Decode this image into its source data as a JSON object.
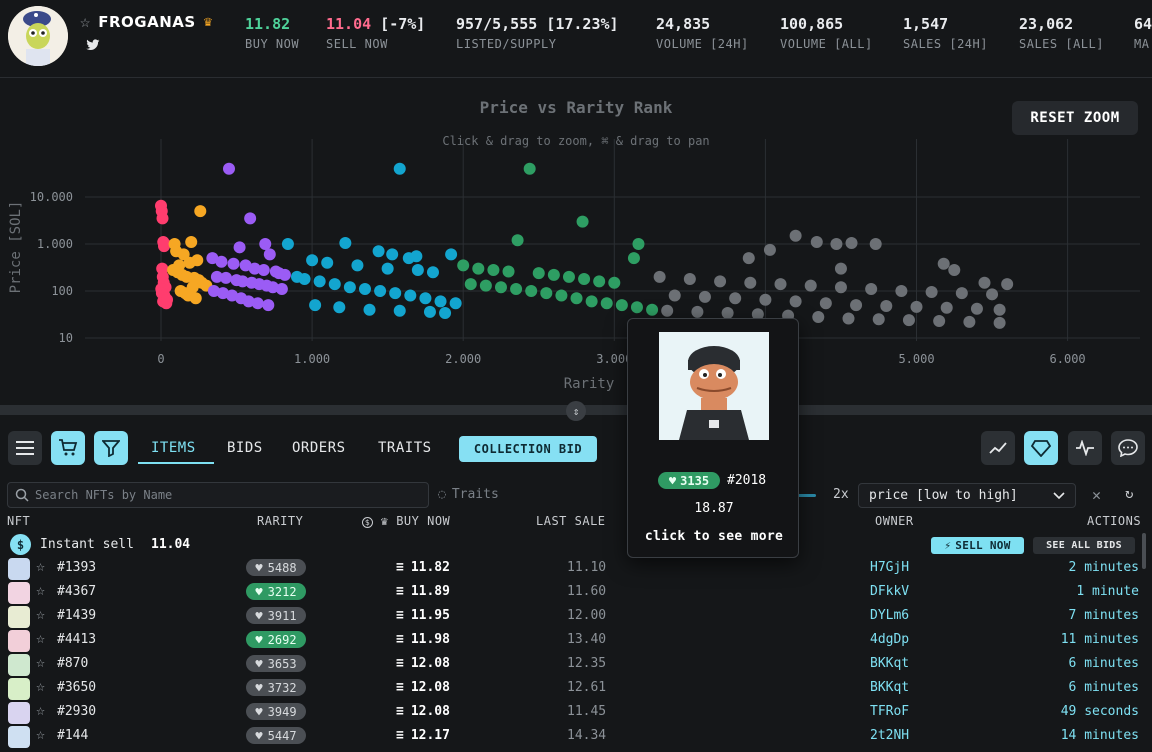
{
  "collection": {
    "name": "FROGANAS",
    "crown_icon": "crown-icon",
    "star_icon": "star-outline-icon",
    "social_icon": "twitter-icon"
  },
  "stats": [
    {
      "value": "11.82",
      "label": "BUY NOW",
      "color": "#4fd29a"
    },
    {
      "value": "11.04",
      "suffix": " [-7%]",
      "label": "SELL NOW",
      "color": "#ff6b8e"
    },
    {
      "value": "957/5,555 [17.23%]",
      "label": "LISTED/SUPPLY"
    },
    {
      "value": "24,835",
      "label": "VOLUME [24H]"
    },
    {
      "value": "100,865",
      "label": "VOLUME [ALL]"
    },
    {
      "value": "1,547",
      "label": "SALES [24H]"
    },
    {
      "value": "23,062",
      "label": "SALES [ALL]"
    },
    {
      "value": "64",
      "label": "MA"
    }
  ],
  "chart": {
    "reset_label": "RESET ZOOM"
  },
  "chart_data": {
    "type": "scatter",
    "title": "Price vs Rarity Rank",
    "subtitle": "Click & drag to zoom, ⌘ & drag to pan",
    "xlabel": "Rarity",
    "ylabel": "Price [SOL]",
    "xlim": [
      -50,
      6150
    ],
    "ylim_log": [
      10,
      30000
    ],
    "x_scale": "linear",
    "y_scale": "log",
    "x_ticks": [
      "0",
      "1.000",
      "2.000",
      "3.000",
      "4.000",
      "5.000",
      "6.000"
    ],
    "y_ticks": [
      "10",
      "100",
      "1.000",
      "10.000"
    ],
    "grid": true,
    "series": [
      {
        "color": "#ff3d6e",
        "x": [
          0,
          5,
          10,
          15,
          20,
          25,
          8,
          12,
          18,
          30,
          2,
          6,
          14,
          22,
          28,
          35,
          40
        ],
        "y": [
          6500,
          5000,
          3500,
          1100,
          900,
          1000,
          300,
          200,
          150,
          120,
          110,
          90,
          60,
          80,
          70,
          55,
          65
        ]
      },
      {
        "color": "#f6a723",
        "x": [
          90,
          100,
          150,
          200,
          260,
          240,
          190,
          120,
          80,
          110,
          140,
          170,
          220,
          250,
          270,
          300,
          210,
          130,
          160,
          180,
          230
        ],
        "y": [
          1000,
          700,
          600,
          1100,
          5000,
          450,
          400,
          350,
          280,
          250,
          220,
          200,
          190,
          170,
          150,
          130,
          120,
          100,
          90,
          80,
          70
        ]
      },
      {
        "color": "#9b5cf5",
        "x": [
          450,
          590,
          520,
          690,
          720,
          340,
          400,
          480,
          560,
          620,
          680,
          760,
          780,
          820,
          370,
          430,
          500,
          540,
          600,
          650,
          700,
          740,
          800,
          350,
          410,
          470,
          530,
          580,
          640,
          710
        ],
        "y": [
          40000,
          3500,
          850,
          1000,
          600,
          500,
          420,
          380,
          350,
          300,
          280,
          260,
          240,
          220,
          200,
          190,
          170,
          160,
          150,
          140,
          130,
          120,
          110,
          100,
          90,
          80,
          70,
          60,
          55,
          50
        ]
      },
      {
        "color": "#13a5cf",
        "x": [
          1580,
          840,
          1220,
          1440,
          1530,
          1640,
          1690,
          1920,
          1000,
          1100,
          1300,
          1500,
          1700,
          1800,
          900,
          950,
          1050,
          1150,
          1250,
          1350,
          1450,
          1550,
          1650,
          1750,
          1850,
          1950,
          1020,
          1180,
          1380,
          1580,
          1780,
          1880
        ],
        "y": [
          40000,
          1000,
          1050,
          700,
          600,
          500,
          550,
          600,
          450,
          400,
          350,
          300,
          280,
          250,
          200,
          180,
          160,
          140,
          120,
          110,
          100,
          90,
          80,
          70,
          60,
          55,
          50,
          45,
          40,
          38,
          36,
          34
        ]
      },
      {
        "color": "#2e9e63",
        "x": [
          2440,
          2790,
          2360,
          3160,
          3130,
          2000,
          2100,
          2200,
          2300,
          2500,
          2600,
          2700,
          2800,
          2900,
          3000,
          2050,
          2150,
          2250,
          2350,
          2450,
          2550,
          2650,
          2750,
          2850,
          2950,
          3050,
          3150,
          3250
        ],
        "y": [
          40000,
          3000,
          1200,
          1000,
          500,
          350,
          300,
          280,
          260,
          240,
          220,
          200,
          180,
          160,
          150,
          140,
          130,
          120,
          110,
          100,
          90,
          80,
          70,
          60,
          55,
          50,
          45,
          40
        ]
      },
      {
        "color": "#6c7075",
        "x": [
          4200,
          4340,
          4470,
          4570,
          4730,
          4030,
          3890,
          4500,
          5180,
          5250,
          5450,
          5600,
          3300,
          3500,
          3700,
          3900,
          4100,
          4300,
          4500,
          4700,
          4900,
          5100,
          5300,
          5500,
          3400,
          3600,
          3800,
          4000,
          4200,
          4400,
          4600,
          4800,
          5000,
          5200,
          5400,
          5550,
          3350,
          3550,
          3750,
          3950,
          4150,
          4350,
          4550,
          4750,
          4950,
          5150,
          5350,
          5550
        ],
        "y": [
          1500,
          1100,
          1000,
          1050,
          1000,
          750,
          500,
          300,
          380,
          280,
          150,
          140,
          200,
          180,
          160,
          150,
          140,
          130,
          120,
          110,
          100,
          95,
          90,
          85,
          80,
          75,
          70,
          65,
          60,
          55,
          50,
          48,
          46,
          44,
          42,
          40,
          38,
          36,
          34,
          32,
          30,
          28,
          26,
          25,
          24,
          23,
          22,
          21
        ]
      }
    ]
  },
  "toolbar": {
    "tabs": [
      "ITEMS",
      "BIDS",
      "ORDERS",
      "TRAITS"
    ],
    "collection_bid": "COLLECTION BID",
    "search_placeholder": "Search NFTs by Name",
    "traits_label": "Traits",
    "grid_size": "2x",
    "sort_value": "price [low to high]"
  },
  "columns": {
    "nft": "NFT",
    "rarity": "RARITY",
    "buy_now": "BUY NOW",
    "last_sale": "LAST SALE",
    "owner": "OWNER",
    "actions": "ACTIONS"
  },
  "instant_sell": {
    "label": "Instant sell",
    "value": "11.04",
    "sell_now": "SELL NOW",
    "see_all_bids": "SEE ALL BIDS"
  },
  "rows": [
    {
      "id": "#1393",
      "rank": "5488",
      "rank_tier": "common",
      "price": "11.82",
      "last": "11.10",
      "owner": "H7GjH",
      "time": "2 minutes",
      "thumb": "#c9d9f0"
    },
    {
      "id": "#4367",
      "rank": "3212",
      "rank_tier": "green",
      "price": "11.89",
      "last": "11.60",
      "owner": "DFkkV",
      "time": "1 minute",
      "thumb": "#f2d4e2"
    },
    {
      "id": "#1439",
      "rank": "3911",
      "rank_tier": "common",
      "price": "11.95",
      "last": "12.00",
      "owner": "DYLm6",
      "time": "7 minutes",
      "thumb": "#e8ecd3"
    },
    {
      "id": "#4413",
      "rank": "2692",
      "rank_tier": "green",
      "price": "11.98",
      "last": "13.40",
      "owner": "4dgDp",
      "time": "11 minutes",
      "thumb": "#f2cfd9"
    },
    {
      "id": "#870",
      "rank": "3653",
      "rank_tier": "common",
      "price": "12.08",
      "last": "12.35",
      "owner": "BKKqt",
      "time": "6 minutes",
      "thumb": "#cfe8cf"
    },
    {
      "id": "#3650",
      "rank": "3732",
      "rank_tier": "common",
      "price": "12.08",
      "last": "12.61",
      "owner": "BKKqt",
      "time": "6 minutes",
      "thumb": "#d8efc8"
    },
    {
      "id": "#2930",
      "rank": "3949",
      "rank_tier": "common",
      "price": "12.08",
      "last": "11.45",
      "owner": "TFRoF",
      "time": "49 seconds",
      "thumb": "#d9d4f0"
    },
    {
      "id": "#144",
      "rank": "5447",
      "rank_tier": "common",
      "price": "12.17",
      "last": "14.34",
      "owner": "2t2NH",
      "time": "14 minutes",
      "thumb": "#cfe0f2"
    }
  ],
  "tooltip": {
    "rank": "3135",
    "id": "#2018",
    "price": "18.87",
    "more": "click to see more"
  }
}
